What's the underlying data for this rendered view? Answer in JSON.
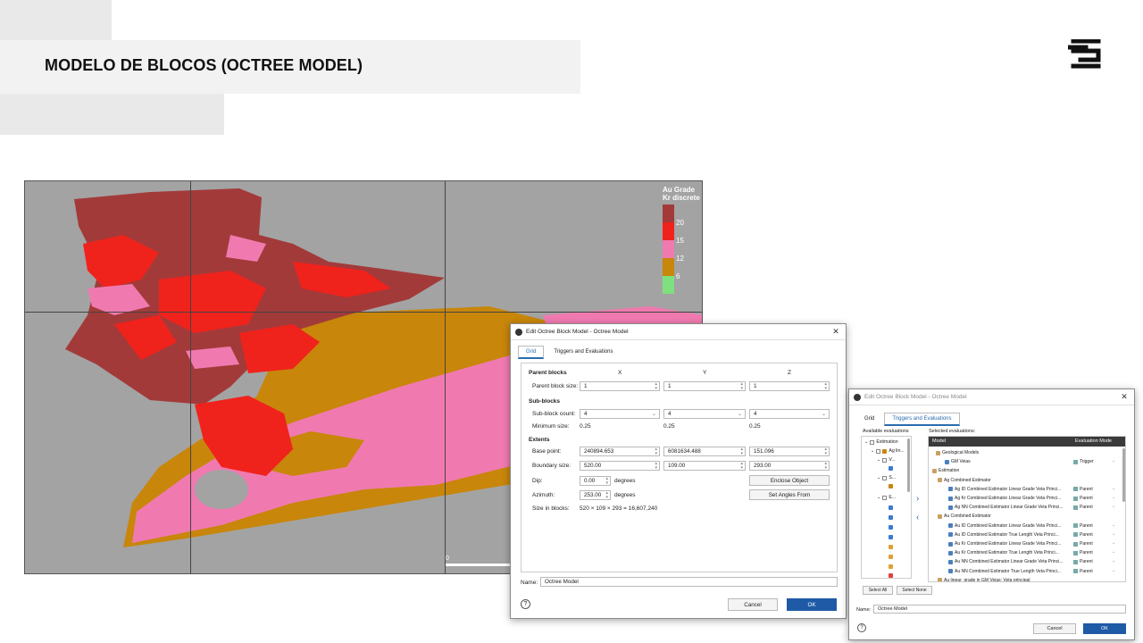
{
  "slide": {
    "title": "MODELO DE BLOCOS (OCTREE MODEL)"
  },
  "legend": {
    "title": "Au Grade\nKr discrete",
    "labels": [
      "20",
      "15",
      "12",
      "6"
    ]
  },
  "viewer": {
    "scale_label": "0"
  },
  "dialog1": {
    "title": "Edit Octree Block Model - Octree Model",
    "tabs": [
      "Grid",
      "Triggers and Evaluations"
    ],
    "columns": [
      "X",
      "Y",
      "Z"
    ],
    "sections": {
      "parent_blocks": "Parent blocks",
      "sub_blocks": "Sub-blocks",
      "extents": "Extents"
    },
    "fields": {
      "parent_block_size": {
        "label": "Parent block size:",
        "values": [
          "1",
          "1",
          "1"
        ]
      },
      "sub_block_count": {
        "label": "Sub-block count:",
        "values": [
          "4",
          "4",
          "4"
        ]
      },
      "minimum_size": {
        "label": "Minimum size:",
        "values": [
          "0.25",
          "0.25",
          "0.25"
        ]
      },
      "base_point": {
        "label": "Base point:",
        "values": [
          "240894.653",
          "6081634.488",
          "151.096"
        ]
      },
      "boundary_size": {
        "label": "Boundary size:",
        "values": [
          "520.00",
          "109.00",
          "293.00"
        ]
      },
      "dip": {
        "label": "Dip:",
        "value": "0.00",
        "unit": "degrees"
      },
      "azimuth": {
        "label": "Azimuth:",
        "value": "253.00",
        "unit": "degrees"
      },
      "size_in_blocks": {
        "label": "Size in blocks:",
        "value": "520 × 109 × 293 = 16,607,240"
      }
    },
    "buttons": {
      "enclose_object": "Enclose Object",
      "set_angles_from": "Set Angles From",
      "cancel": "Cancel",
      "ok": "OK"
    },
    "name_label": "Name:",
    "name_value": "Octree Model"
  },
  "dialog2": {
    "title": "Edit Octree Block Model - Octree Model",
    "tabs": [
      "Grid",
      "Triggers and Evaluations"
    ],
    "available_label": "Available evaluations",
    "selected_label": "Selected evaluations:",
    "available_items": [
      "Estimation",
      "Ag lin...",
      "V...",
      "S...",
      "E..."
    ],
    "columns": [
      "Model",
      "Evaluation Mode"
    ],
    "rows": [
      {
        "name": "Geological Models",
        "mode": ""
      },
      {
        "name": "GM Veias",
        "mode": "Trigger"
      },
      {
        "name": "Estimation",
        "mode": ""
      },
      {
        "name": "Ag Combined Estimator",
        "mode": ""
      },
      {
        "name": "Ag ID Combined Estimator Linear Grade Veta Princi...",
        "mode": "Parent"
      },
      {
        "name": "Ag Kr Combined Estimator Linear Grade Veta Princi...",
        "mode": "Parent"
      },
      {
        "name": "Ag NN Combined Estimator Linear Grade Veta Princi...",
        "mode": "Parent"
      },
      {
        "name": "Au Combined Estimator",
        "mode": ""
      },
      {
        "name": "Au ID Combined Estimator Linear Grade Veta Princi...",
        "mode": "Parent"
      },
      {
        "name": "Au ID Combined Estimator True Length Veta Princi...",
        "mode": "Parent"
      },
      {
        "name": "Au Kr Combined Estimator Linear Grade Veta Princi...",
        "mode": "Parent"
      },
      {
        "name": "Au Kr Combined Estimator True Length Veta Princi...",
        "mode": "Parent"
      },
      {
        "name": "Au NN Combined Estimator Linear Grade Veta Princi...",
        "mode": "Parent"
      },
      {
        "name": "Au NN Combined Estimator True Length Veta Princi...",
        "mode": "Parent"
      },
      {
        "name": "Au linear_grade in GM Veias: Veta principal",
        "mode": ""
      }
    ],
    "buttons": {
      "select_all": "Select All",
      "select_none": "Select None",
      "cancel": "Cancel",
      "ok": "OK"
    },
    "name_label": "Name:",
    "name_value": "Octree Model"
  },
  "colors": {
    "dark_red": "#a33a3a",
    "red": "#f0221c",
    "pink": "#f07ab0",
    "ochre": "#c8860a",
    "green": "#7fe07f",
    "accent_blue": "#1f5aa6"
  }
}
